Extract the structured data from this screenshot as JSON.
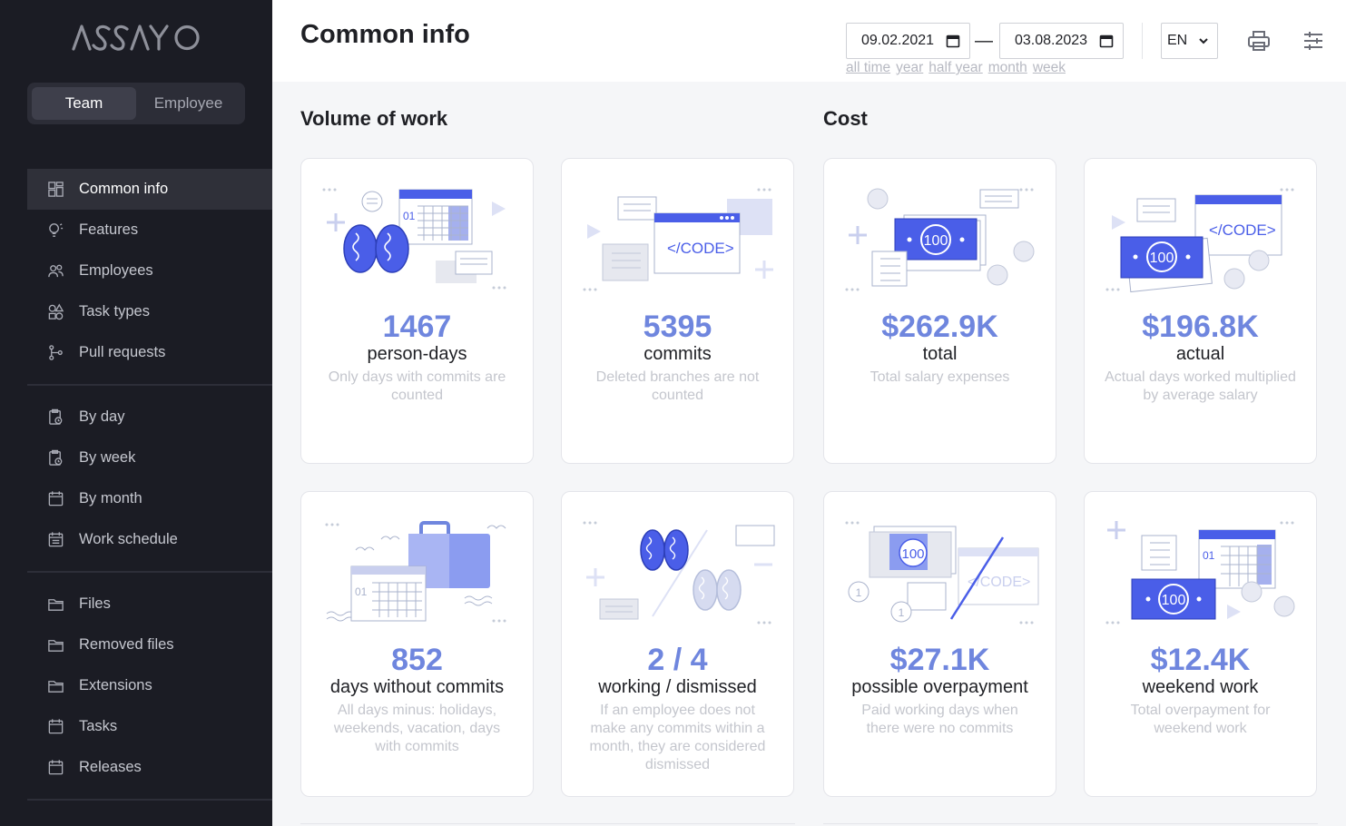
{
  "sidebar": {
    "logo": "ASSAYO",
    "toggle": [
      {
        "label": "Team"
      },
      {
        "label": "Employee"
      }
    ],
    "groups": [
      [
        {
          "label": "Common info",
          "icon": "grid-icon"
        },
        {
          "label": "Features",
          "icon": "lightbulb-icon"
        },
        {
          "label": "Employees",
          "icon": "users-icon"
        },
        {
          "label": "Task types",
          "icon": "shapes-icon"
        },
        {
          "label": "Pull requests",
          "icon": "git-branch-icon"
        }
      ],
      [
        {
          "label": "By day",
          "icon": "clipboard-clock-icon"
        },
        {
          "label": "By week",
          "icon": "clipboard-clock-icon"
        },
        {
          "label": "By month",
          "icon": "calendar-icon"
        },
        {
          "label": "Work schedule",
          "icon": "calendar-list-icon"
        }
      ],
      [
        {
          "label": "Files",
          "icon": "folder-icon"
        },
        {
          "label": "Removed files",
          "icon": "folder-icon"
        },
        {
          "label": "Extensions",
          "icon": "folder-icon"
        },
        {
          "label": "Tasks",
          "icon": "calendar-icon"
        },
        {
          "label": "Releases",
          "icon": "calendar-icon"
        }
      ]
    ]
  },
  "header": {
    "title": "Common info",
    "date_from": "09.02.2021",
    "date_to": "03.08.2023",
    "date_separator": "—",
    "quick_ranges": [
      "all time",
      "year",
      "half year",
      "month",
      "week"
    ],
    "language": "EN"
  },
  "sections": {
    "volume": "Volume of work",
    "cost": "Cost"
  },
  "cards": [
    {
      "value": "1467",
      "unit": "person-days",
      "desc": "Only days with commits are counted",
      "illus": "brain-calendar"
    },
    {
      "value": "5395",
      "unit": "commits",
      "desc": "Deleted branches are not counted",
      "illus": "code"
    },
    {
      "value": "$262.9K",
      "unit": "total",
      "desc": "Total salary expenses",
      "illus": "money"
    },
    {
      "value": "$196.8K",
      "unit": "actual",
      "desc": "Actual days worked multiplied by average salary",
      "illus": "money-code"
    },
    {
      "value": "852",
      "unit": "days without commits",
      "desc": "All days minus: holidays, weekends, vacation, days with commits",
      "illus": "suitcase-calendar"
    },
    {
      "value": "2 / 4",
      "unit": "working / dismissed",
      "desc": "If an employee does not make any commits within a month, they are considered dismissed",
      "illus": "brains"
    },
    {
      "value": "$27.1K",
      "unit": "possible overpayment",
      "desc": "Paid working days when there were no commits",
      "illus": "money-code-crossed"
    },
    {
      "value": "$12.4K",
      "unit": "weekend work",
      "desc": "Total overpayment for weekend work",
      "illus": "money-calendar"
    }
  ],
  "colors": {
    "sidebar_bg": "#1b1c24",
    "accent": "#6f86de",
    "illus_blue": "#4a5ee8"
  }
}
